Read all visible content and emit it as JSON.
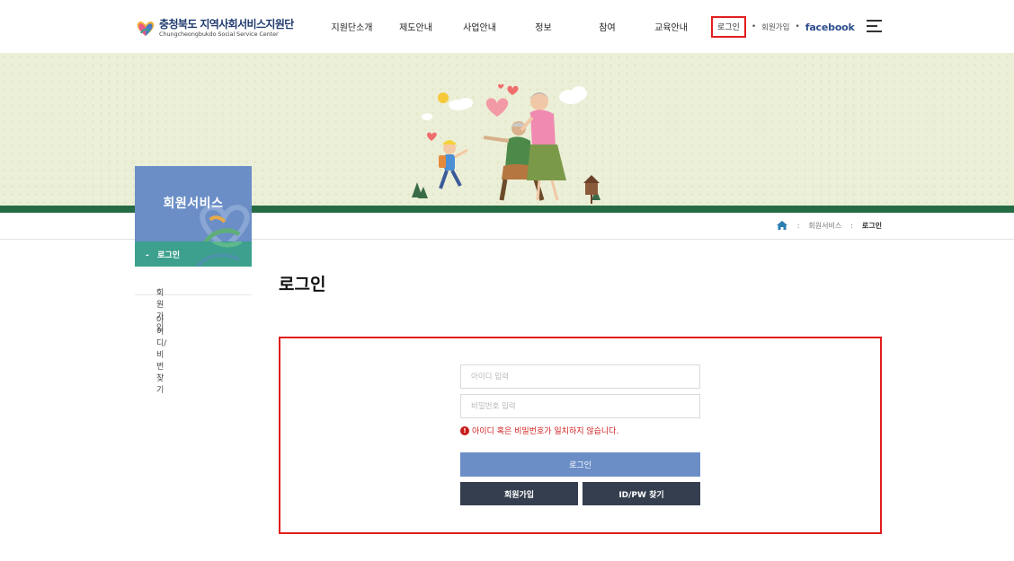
{
  "header": {
    "logo_title": "충청북도 지역사회서비스지원단",
    "logo_subtitle": "Chungcheongbukdo Social Service Center",
    "nav": [
      "지원단소개",
      "제도안내",
      "사업안내",
      "정보",
      "참여",
      "교육안내"
    ],
    "login_link": "로그인",
    "join_link": "회원가입",
    "facebook_link": "facebook",
    "separator": "•"
  },
  "breadcrumb": {
    "section": "회원서비스",
    "current": "로그인",
    "separator": ":"
  },
  "sidebar": {
    "title": "회원서비스",
    "items": [
      {
        "label": "로그인",
        "active": true
      },
      {
        "label": "회원가입",
        "active": false
      },
      {
        "label": "아이디/비번찾기",
        "active": false
      }
    ],
    "bullet": "-"
  },
  "main": {
    "title": "로그인",
    "form": {
      "id_placeholder": "아이디 입력",
      "id_value": "",
      "pw_placeholder": "비밀번호 입력",
      "pw_value": "",
      "error_icon": "!",
      "error_message": "아이디 혹은 비밀번호가 일치하지 않습니다.",
      "login_button": "로그인",
      "join_button": "회원가입",
      "find_button": "ID/PW 찾기"
    }
  },
  "colors": {
    "accent_blue": "#6b8ec7",
    "accent_green": "#3da08e",
    "banner_line": "#256b43",
    "dark_button": "#343e4e",
    "error_red": "#d11f1f",
    "highlight_border": "#e21d1d"
  },
  "icons": {
    "home": "home-icon",
    "menu": "hamburger-menu-icon",
    "error": "alert-circle-icon"
  }
}
